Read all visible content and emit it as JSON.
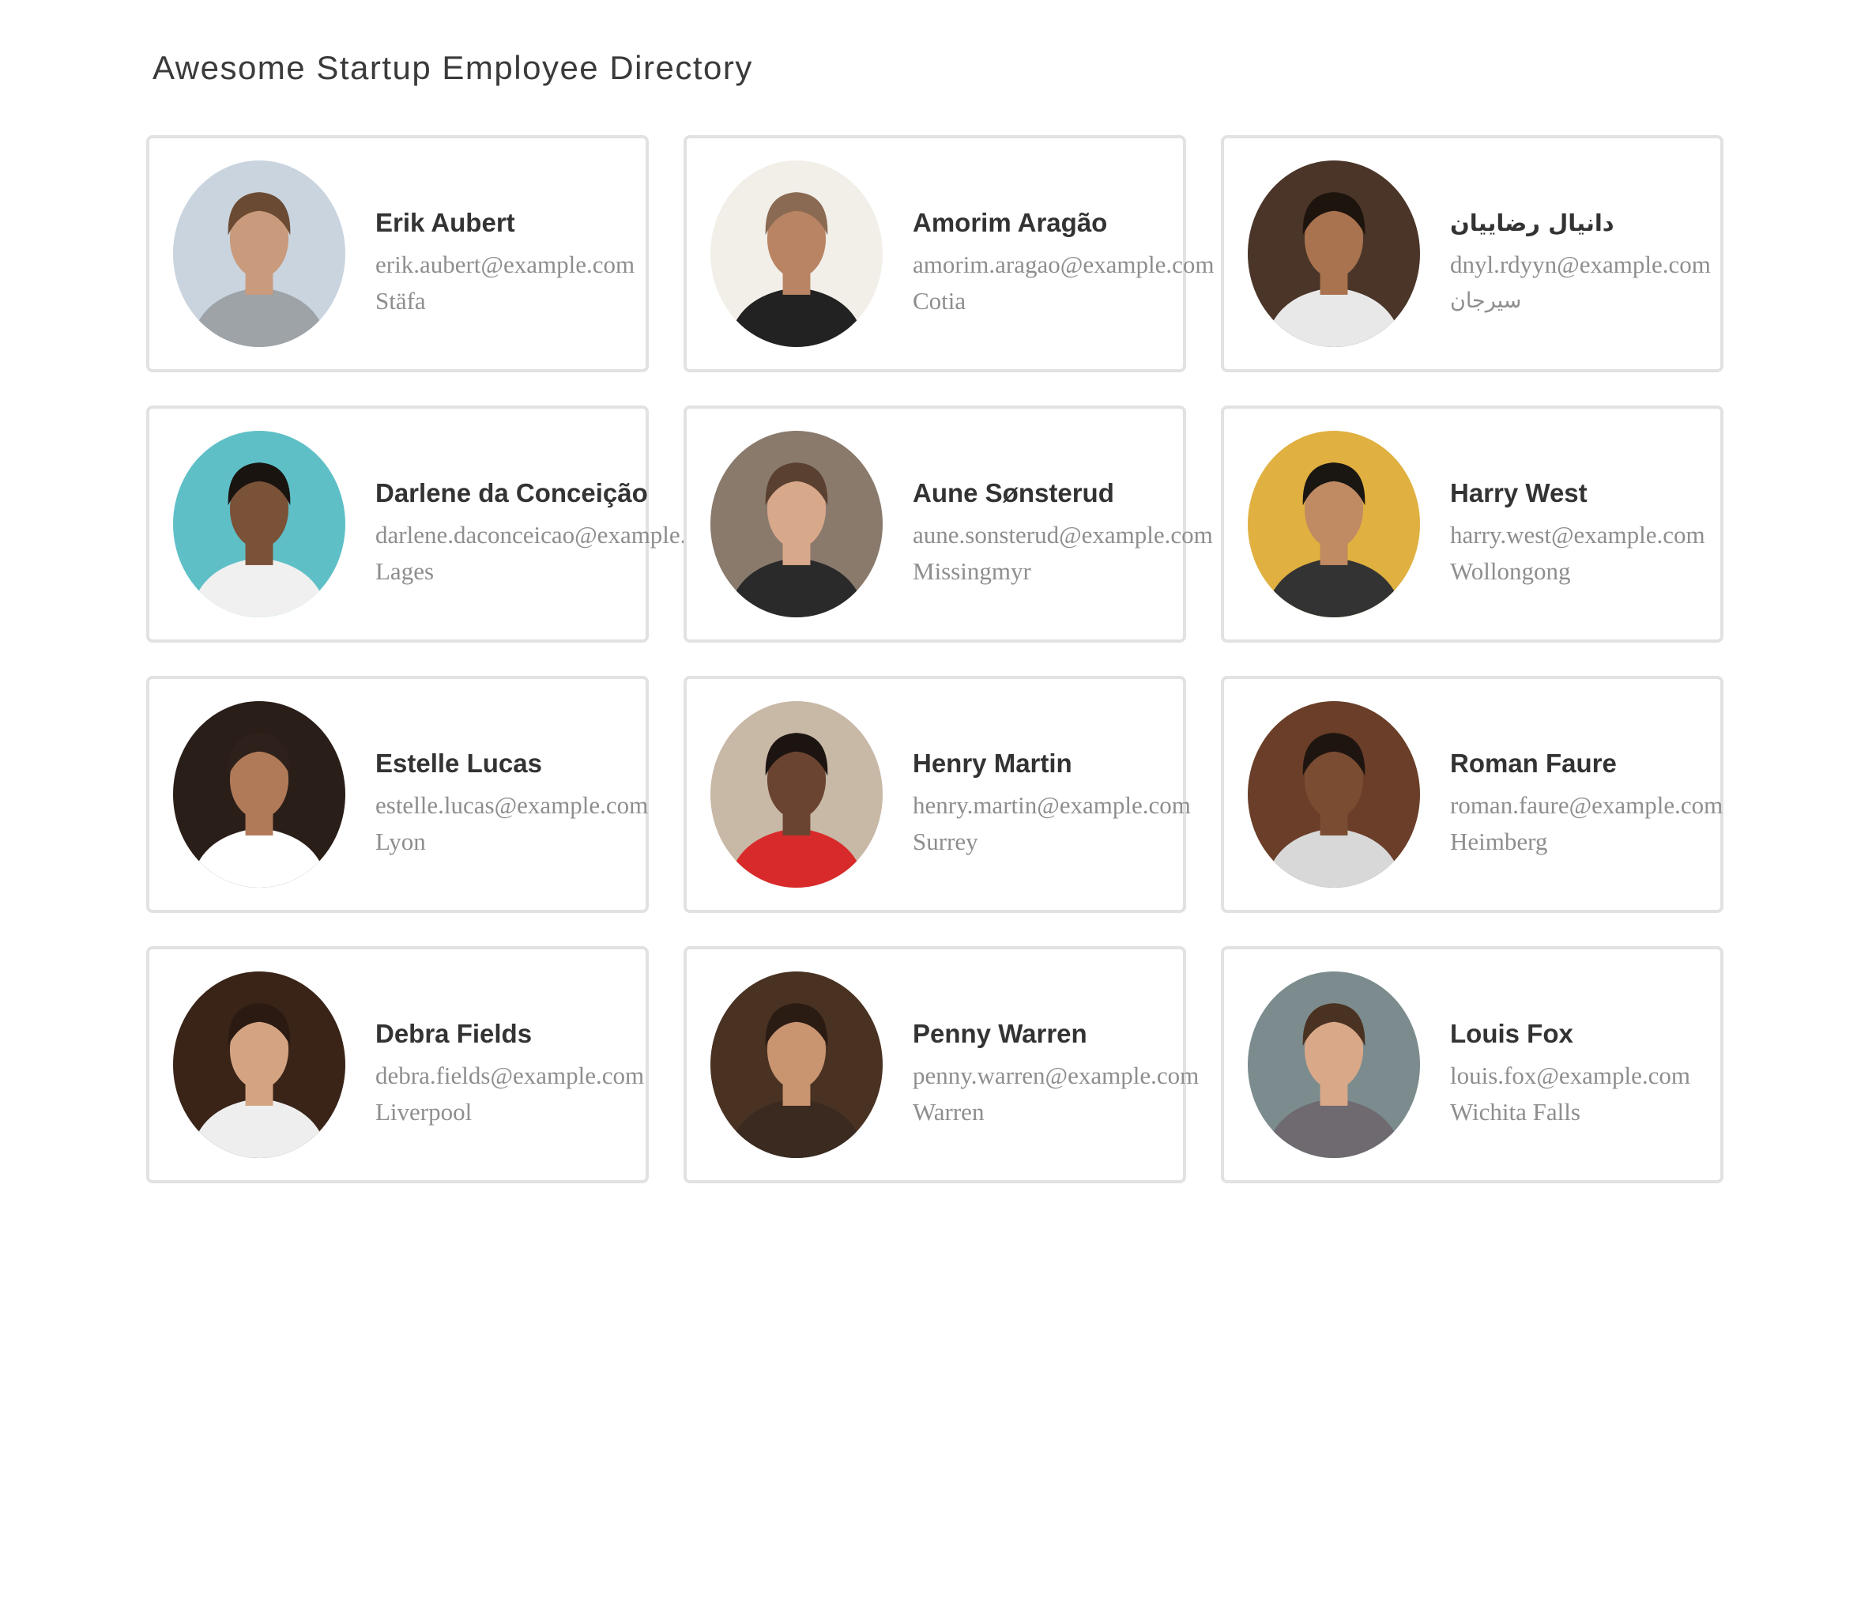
{
  "page": {
    "title": "Awesome Startup Employee Directory"
  },
  "colors": {
    "card_border": "#e2e2e2",
    "name_text": "#333333",
    "detail_text": "#8e8e8e",
    "title_text": "#3a3a3a",
    "background": "#ffffff"
  },
  "employees": [
    {
      "name": "Erik Aubert",
      "email": "erik.aubert@example.com",
      "location": "Stäfa",
      "avatar_icon": "person-photo",
      "tones": {
        "bg": "#c9d4de",
        "skin": "#c99a7c",
        "hair": "#6b4a33",
        "shirt": "#9ea3a8"
      }
    },
    {
      "name": "Amorim Aragão",
      "email": "amorim.aragao@example.com",
      "location": "Cotia",
      "avatar_icon": "person-photo",
      "tones": {
        "bg": "#f2efe9",
        "skin": "#b88463",
        "hair": "#8a6a52",
        "shirt": "#222222"
      }
    },
    {
      "name": "دانيال رضاييان",
      "email": "dnyl.rdyyn@example.com",
      "location": "سيرجان",
      "avatar_icon": "person-photo",
      "tones": {
        "bg": "#4a3528",
        "skin": "#a8734e",
        "hair": "#1e140e",
        "shirt": "#e8e8e8"
      }
    },
    {
      "name": "Darlene da Conceição",
      "email": "darlene.daconceicao@example.com",
      "location": "Lages",
      "avatar_icon": "person-photo",
      "tones": {
        "bg": "#5fbfc7",
        "skin": "#7a5238",
        "hair": "#1a1411",
        "shirt": "#f0f0f0"
      }
    },
    {
      "name": "Aune Sønsterud",
      "email": "aune.sonsterud@example.com",
      "location": "Missingmyr",
      "avatar_icon": "person-photo",
      "tones": {
        "bg": "#8a7a6c",
        "skin": "#d8a88a",
        "hair": "#5a4030",
        "shirt": "#2a2a2a"
      }
    },
    {
      "name": "Harry West",
      "email": "harry.west@example.com",
      "location": "Wollongong",
      "avatar_icon": "person-photo",
      "tones": {
        "bg": "#e0b040",
        "skin": "#c08a62",
        "hair": "#1a1612",
        "shirt": "#333333"
      }
    },
    {
      "name": "Estelle Lucas",
      "email": "estelle.lucas@example.com",
      "location": "Lyon",
      "avatar_icon": "person-photo",
      "tones": {
        "bg": "#2a1e19",
        "skin": "#b07a58",
        "hair": "#2e201a",
        "shirt": "#ffffff"
      }
    },
    {
      "name": "Henry Martin",
      "email": "henry.martin@example.com",
      "location": "Surrey",
      "avatar_icon": "person-photo",
      "tones": {
        "bg": "#c8b8a6",
        "skin": "#6a4430",
        "hair": "#1c1410",
        "shirt": "#d82a2a"
      }
    },
    {
      "name": "Roman Faure",
      "email": "roman.faure@example.com",
      "location": "Heimberg",
      "avatar_icon": "person-photo",
      "tones": {
        "bg": "#6a3e28",
        "skin": "#7a4c32",
        "hair": "#1f1510",
        "shirt": "#d8d8d8"
      }
    },
    {
      "name": "Debra Fields",
      "email": "debra.fields@example.com",
      "location": "Liverpool",
      "avatar_icon": "person-photo",
      "tones": {
        "bg": "#3a2418",
        "skin": "#d4a482",
        "hair": "#2a1a12",
        "shirt": "#eeeeee"
      }
    },
    {
      "name": "Penny Warren",
      "email": "penny.warren@example.com",
      "location": "Warren",
      "avatar_icon": "person-photo",
      "tones": {
        "bg": "#4a3222",
        "skin": "#c99470",
        "hair": "#2b1c13",
        "shirt": "#3a2a20"
      }
    },
    {
      "name": "Louis Fox",
      "email": "louis.fox@example.com",
      "location": "Wichita Falls",
      "avatar_icon": "person-photo",
      "tones": {
        "bg": "#7c8c8e",
        "skin": "#d8a888",
        "hair": "#4a3222",
        "shirt": "#6e6a70"
      }
    }
  ]
}
